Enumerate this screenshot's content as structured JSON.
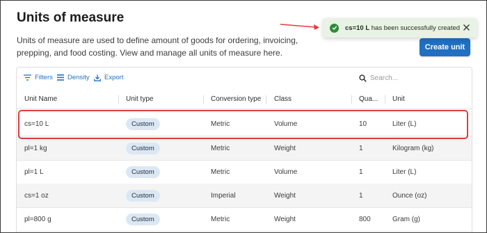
{
  "header": {
    "title": "Units of measure",
    "description": "Units of measure are used to define amount of goods for ordering, invoicing, prepping, and food costing. View and manage all units of measure here.",
    "create_button": "Create unit"
  },
  "toast": {
    "item": "cs=10 L",
    "message": " has been successfully created",
    "icon": "check-circle-icon",
    "color": "#2e8b3e",
    "background": "#e8f3e6"
  },
  "toolbar": {
    "filters_label": "Filters",
    "density_label": "Density",
    "export_label": "Export",
    "search_placeholder": "Search..."
  },
  "table": {
    "columns": {
      "unit_name": "Unit Name",
      "unit_type": "Unit type",
      "conversion_type": "Conversion type",
      "class": "Class",
      "quantity": "Qua...",
      "unit": "Unit"
    },
    "rows": [
      {
        "unit_name": "cs=10 L",
        "unit_type": "Custom",
        "conversion_type": "Metric",
        "class": "Volume",
        "quantity": "10",
        "unit": "Liter (L)"
      },
      {
        "unit_name": "pl=1 kg",
        "unit_type": "Custom",
        "conversion_type": "Metric",
        "class": "Weight",
        "quantity": "1",
        "unit": "Kilogram (kg)"
      },
      {
        "unit_name": "pl=1 L",
        "unit_type": "Custom",
        "conversion_type": "Metric",
        "class": "Volume",
        "quantity": "1",
        "unit": "Liter (L)"
      },
      {
        "unit_name": "cs=1 oz",
        "unit_type": "Custom",
        "conversion_type": "Imperial",
        "class": "Weight",
        "quantity": "1",
        "unit": "Ounce (oz)"
      },
      {
        "unit_name": "pl=800 g",
        "unit_type": "Custom",
        "conversion_type": "Metric",
        "class": "Weight",
        "quantity": "800",
        "unit": "Gram (g)"
      }
    ]
  },
  "colors": {
    "accent": "#1f6fc2",
    "chip": "#dbe8f4",
    "highlight": "#e03c3c",
    "arrow": "#e03c3c"
  }
}
